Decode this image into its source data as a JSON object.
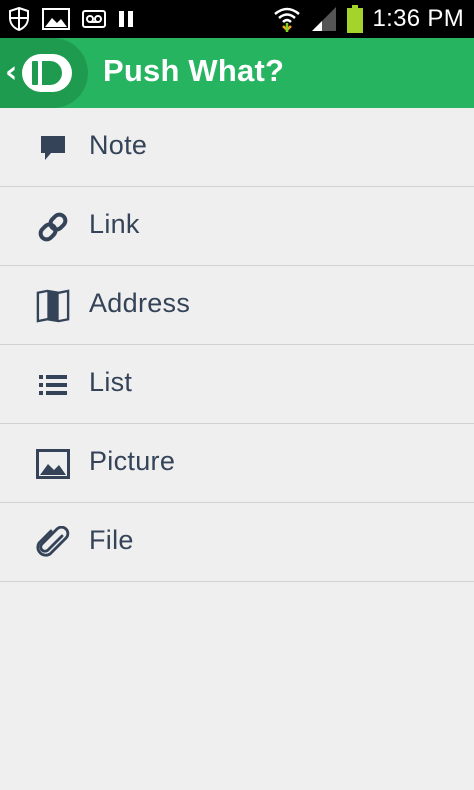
{
  "status_bar": {
    "icons_left": [
      "shield-icon",
      "image-icon",
      "voicemail-icon",
      "pause-icon"
    ],
    "icons_right": [
      "wifi-icon",
      "signal-icon",
      "battery-icon"
    ],
    "time": "1:36 PM",
    "battery_color": "#a4d42c"
  },
  "action_bar": {
    "title": "Push What?",
    "background_color": "#27b461",
    "up_chevron": "‹"
  },
  "menu": {
    "items": [
      {
        "label": "Note",
        "icon": "speech-bubble-icon"
      },
      {
        "label": "Link",
        "icon": "chain-link-icon"
      },
      {
        "label": "Address",
        "icon": "map-icon"
      },
      {
        "label": "List",
        "icon": "list-icon"
      },
      {
        "label": "Picture",
        "icon": "picture-icon"
      },
      {
        "label": "File",
        "icon": "paperclip-icon"
      }
    ],
    "text_color": "#344358"
  }
}
